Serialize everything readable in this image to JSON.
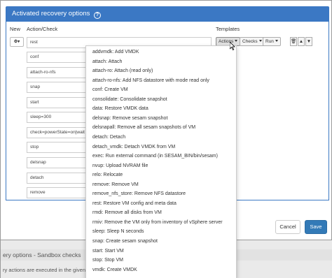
{
  "panel": {
    "title": "Activated recovery options",
    "columns": {
      "new": "New",
      "action_check": "Action/Check",
      "templates": "Templates"
    }
  },
  "rows": [
    {
      "value": "rest"
    },
    {
      "value": "conf"
    },
    {
      "value": "attach-ro-nfs"
    },
    {
      "value": "snap"
    },
    {
      "value": "start"
    },
    {
      "value": "sleep=300"
    },
    {
      "value": "check=powerState=on|wait"
    },
    {
      "value": "stop"
    },
    {
      "value": "delsnap"
    },
    {
      "value": "detach"
    },
    {
      "value": "remove"
    }
  ],
  "templates": {
    "actions_label": "Actions",
    "checks_label": "Checks",
    "run_label": "Run"
  },
  "dropdown_items": [
    "addvmdk: Add VMDK",
    "attach: Attach",
    "attach-ro: Attach (read only)",
    "attach-ro-nfs: Add NFS datastore with mode read only",
    "conf: Create VM",
    "consolidate: Consolidate snapshot",
    "data: Restore VMDK data",
    "delsnap: Remove sesam snapshot",
    "delsnapall: Remove all sesam snapshots of VM",
    "detach: Detach",
    "detach_vmdk: Detach VMDK from VM",
    "exec: Run external command (in SESAM_BIN/bin/sesam)",
    "nvup: Upload NVRAM file",
    "relo: Relocate",
    "remove: Remove VM",
    "remove_nfs_store: Remove NFS datastore",
    "rest: Restore VM config and meta data",
    "rmdi: Remove all disks from VM",
    "rmiv: Remove the VM only from inventory of vSphere server",
    "sleep: Sleep N seconds",
    "snap: Create sesam snapshot",
    "start: Start VM",
    "stop: Stop VM",
    "vmdk: Create VMDK"
  ],
  "buttons": {
    "cancel": "Cancel",
    "save": "Save"
  },
  "background": {
    "title": "ery options - Sandbox checks",
    "text": "ry actions are executed in the given o"
  },
  "colors": {
    "header": "#3b78c4",
    "save": "#337ab7"
  }
}
